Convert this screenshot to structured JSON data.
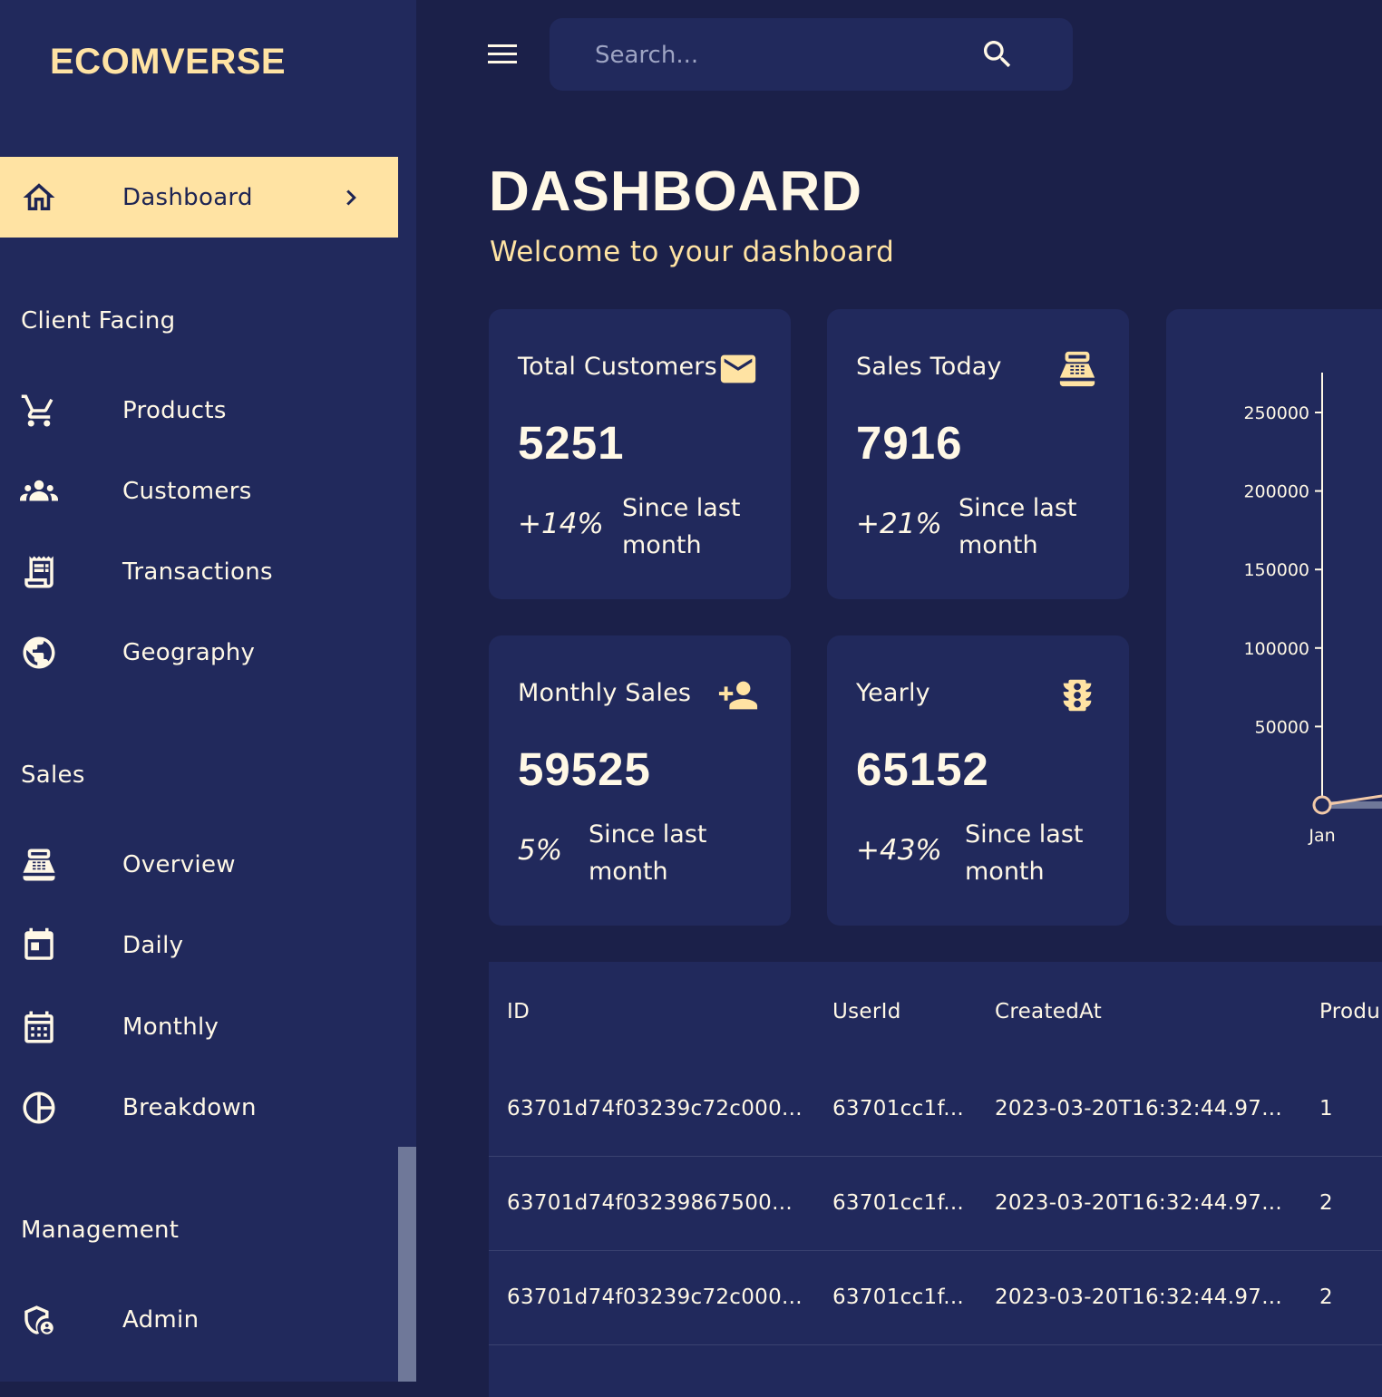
{
  "brand": "ECOMVERSE",
  "colors": {
    "sidebar_bg": "#21295c",
    "page_bg": "#1b2049",
    "accent": "#ffe3a3",
    "text": "#fff8e6"
  },
  "sidebar": {
    "active": {
      "label": "Dashboard",
      "icon": "home-icon"
    },
    "sections": [
      {
        "title": "Client Facing",
        "items": [
          {
            "label": "Products",
            "icon": "shopping-cart-icon"
          },
          {
            "label": "Customers",
            "icon": "groups-icon"
          },
          {
            "label": "Transactions",
            "icon": "receipt-icon"
          },
          {
            "label": "Geography",
            "icon": "globe-icon"
          }
        ]
      },
      {
        "title": "Sales",
        "items": [
          {
            "label": "Overview",
            "icon": "point-of-sale-icon"
          },
          {
            "label": "Daily",
            "icon": "today-icon"
          },
          {
            "label": "Monthly",
            "icon": "calendar-month-icon"
          },
          {
            "label": "Breakdown",
            "icon": "pie-chart-icon"
          }
        ]
      },
      {
        "title": "Management",
        "items": [
          {
            "label": "Admin",
            "icon": "admin-shield-icon"
          }
        ]
      }
    ]
  },
  "topbar": {
    "search_placeholder": "Search...",
    "menu_icon": "menu-icon",
    "search_icon": "search-icon"
  },
  "header": {
    "title": "DASHBOARD",
    "subtitle": "Welcome to your dashboard"
  },
  "stats": [
    {
      "title": "Total Customers",
      "value": "5251",
      "change": "+14%",
      "since": "Since last month",
      "icon": "email-icon"
    },
    {
      "title": "Sales Today",
      "value": "7916",
      "change": "+21%",
      "since": "Since last month",
      "icon": "point-of-sale-icon"
    },
    {
      "title": "Monthly Sales",
      "value": "59525",
      "change": "5%",
      "since": "Since last month",
      "icon": "person-add-icon"
    },
    {
      "title": "Yearly",
      "value": "65152",
      "change": "+43%",
      "since": "Since last month",
      "icon": "traffic-icon"
    }
  ],
  "chart_data": {
    "type": "line",
    "x": [
      "Jan"
    ],
    "series": [
      {
        "values": [
          0
        ]
      }
    ],
    "yticks": [
      50000,
      100000,
      150000,
      200000,
      250000
    ],
    "ylim": [
      0,
      270000
    ],
    "grid": false
  },
  "table": {
    "columns": [
      "ID",
      "UserId",
      "CreatedAt",
      "Produ"
    ],
    "rows": [
      [
        "63701d74f03239c72c000...",
        "63701cc1f...",
        "2023-03-20T16:32:44.97...",
        "1"
      ],
      [
        "63701d74f03239867500...",
        "63701cc1f...",
        "2023-03-20T16:32:44.97...",
        "2"
      ],
      [
        "63701d74f03239c72c000...",
        "63701cc1f...",
        "2023-03-20T16:32:44.97...",
        "2"
      ]
    ]
  }
}
